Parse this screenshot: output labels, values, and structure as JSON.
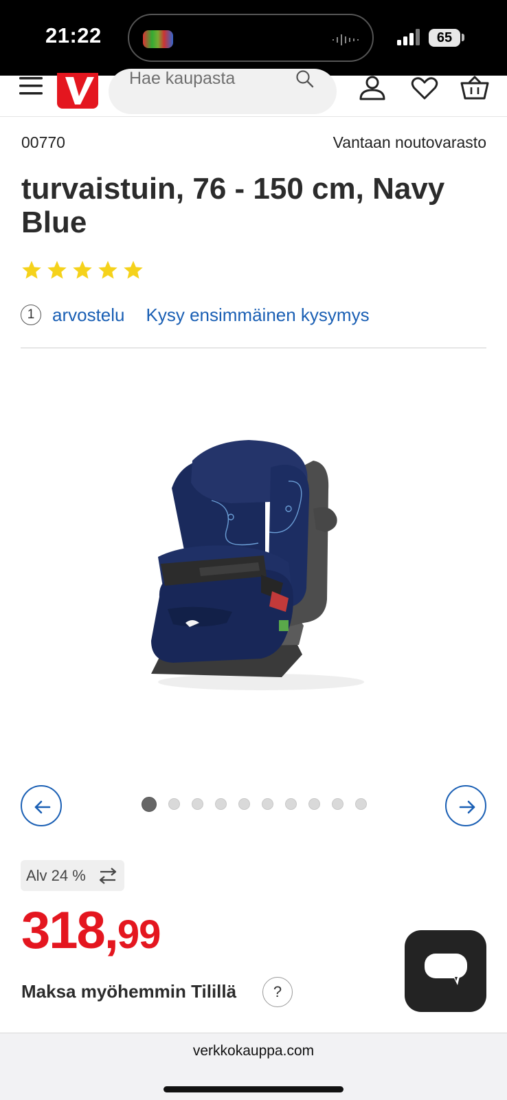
{
  "status_bar": {
    "time": "21:22",
    "battery": "65"
  },
  "header": {
    "search_placeholder": "Hae kaupasta",
    "brand_color": "#e4161f"
  },
  "product": {
    "sku": "00770",
    "store": "Vantaan noutovarasto",
    "title": "turvaistuin, 76 - 150 cm, Navy Blue",
    "rating": 5,
    "review_count": "1",
    "reviews_link": "arvostelu",
    "question_link": "Kysy ensimmäinen kysymys"
  },
  "gallery": {
    "image_count": 10,
    "current_index": 1
  },
  "pricing": {
    "vat_label": "Alv 24 %",
    "price_int": "318,",
    "price_dec": "99",
    "price_color": "#e4161f",
    "pay_later": "Maksa myöhemmin Tilillä",
    "help_label": "?"
  },
  "browser": {
    "url": "verkkokauppa.com"
  },
  "colors": {
    "link": "#1a5fb4",
    "star": "#f5d21b"
  }
}
